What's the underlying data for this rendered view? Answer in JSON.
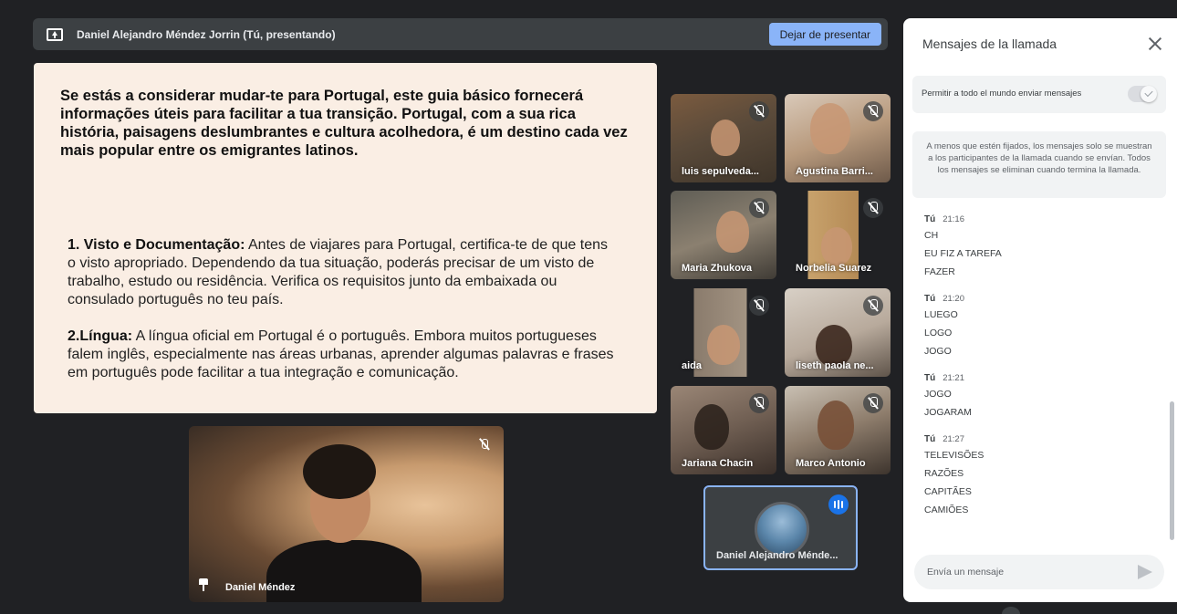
{
  "presentation_bar": {
    "presenter": "Daniel Alejandro Méndez Jorrin (Tú, presentando)",
    "stop_label": "Dejar de presentar"
  },
  "slide": {
    "intro": "Se estás a considerar mudar-te para Portugal, este guia básico fornecerá informações úteis para facilitar a tua transição. Portugal, com a sua rica história, paisagens deslumbrantes e cultura acolhedora, é um destino cada vez mais popular entre os emigrantes latinos.",
    "section1_title": "1. Visto e Documentação:",
    "section1_text": " Antes de viajares para Portugal, certifica-te de que tens o visto apropriado. Dependendo da tua situação, poderás precisar de um visto de trabalho, estudo ou residência. Verifica os requisitos junto da embaixada ou consulado português no teu país.",
    "section2_title": "2.Língua:",
    "section2_text": " A língua oficial em Portugal é o português. Embora muitos portugueses falem inglês, especialmente nas áreas urbanas, aprender algumas palavras e frases em português pode facilitar a tua integração e comunicação."
  },
  "participants": [
    {
      "name": "luis sepulveda..."
    },
    {
      "name": "Agustina Barri..."
    },
    {
      "name": "Maria Zhukova"
    },
    {
      "name": "Norbelia Suarez"
    },
    {
      "name": "aida"
    },
    {
      "name": "liseth paola ne..."
    },
    {
      "name": "Jariana Chacin"
    },
    {
      "name": "Marco Antonio"
    }
  ],
  "self_tile": {
    "name": "Daniel Alejandro Ménde..."
  },
  "main_video": {
    "name": "Daniel Méndez"
  },
  "chat": {
    "title": "Mensajes de la llamada",
    "allow_label": "Permitir a todo el mundo enviar mensajes",
    "info": "A menos que estén fijados, los mensajes solo se muestran a los participantes de la llamada cuando se envían. Todos los mensajes se eliminan cuando termina la llamada.",
    "groups": [
      {
        "sender": "Tú",
        "time": "21:16",
        "lines": [
          "CH",
          "EU FIZ A TAREFA",
          "FAZER"
        ]
      },
      {
        "sender": "Tú",
        "time": "21:20",
        "lines": [
          "LUEGO",
          "LOGO",
          "JOGO"
        ]
      },
      {
        "sender": "Tú",
        "time": "21:21",
        "lines": [
          "JOGO",
          "JOGARAM"
        ]
      },
      {
        "sender": "Tú",
        "time": "21:27",
        "lines": [
          "TELEVISÕES",
          "RAZÕES",
          "CAPITÃES",
          "CAMIÕES"
        ]
      }
    ],
    "input_placeholder": "Envía un mensaje"
  }
}
